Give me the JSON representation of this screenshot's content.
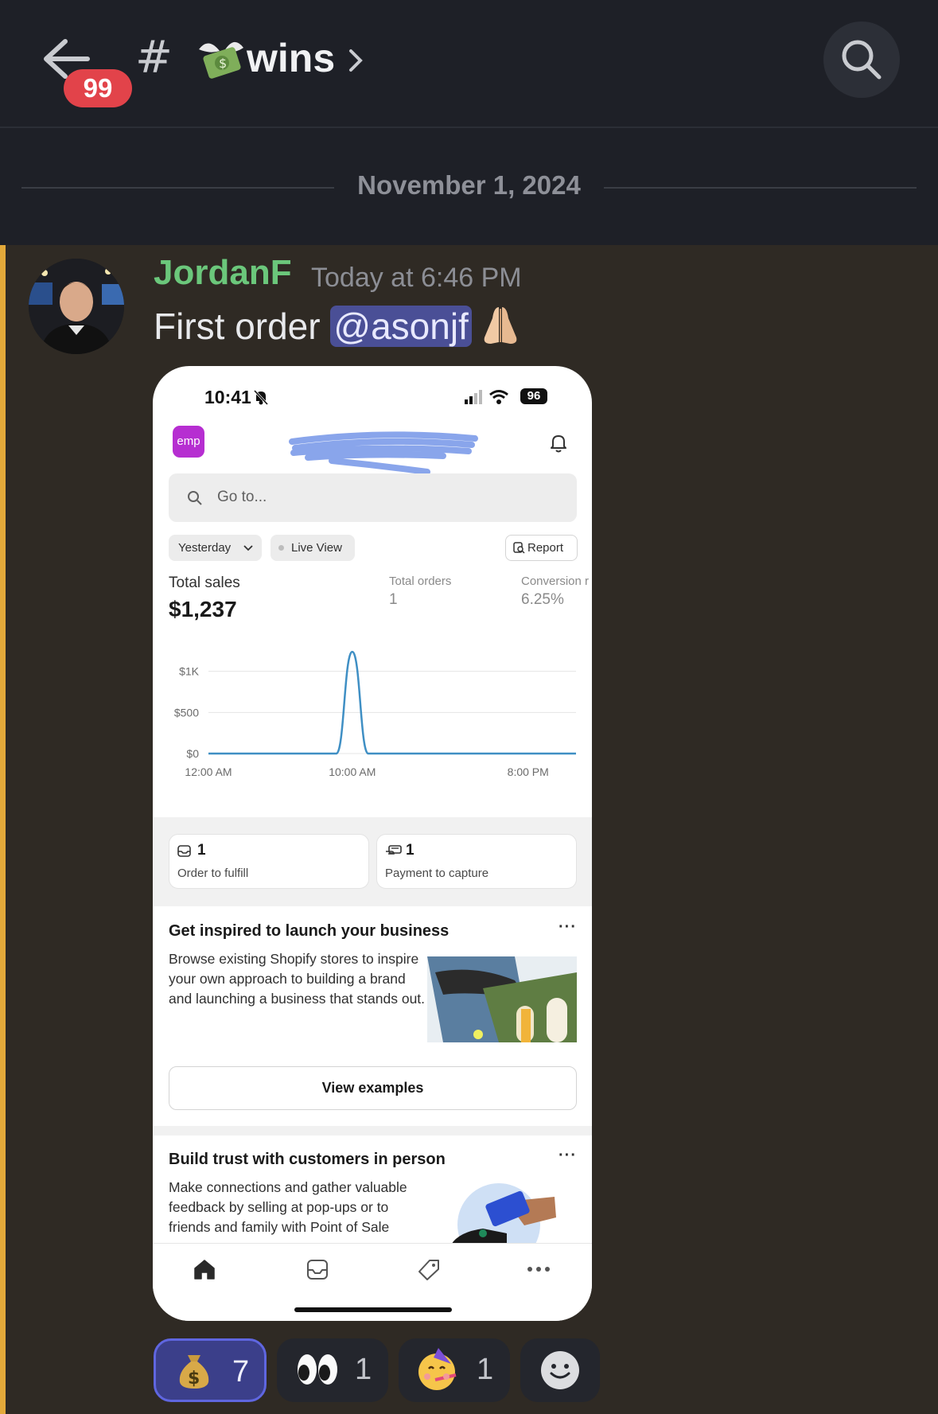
{
  "header": {
    "unread_badge": "99",
    "channel_prefix": "#",
    "channel_name": "wins",
    "channel_emoji": "money-with-wings-icon"
  },
  "date_divider": "November 1, 2024",
  "message": {
    "author": "JordanF",
    "timestamp": "Today at 6:46 PM",
    "text_before": "First order",
    "mention": "@asonjf",
    "emoji": "folded-hands-icon",
    "colors": {
      "author": "#6bc77b",
      "accent_bar": "#e3a93a",
      "mention_bg": "#4a4f96"
    }
  },
  "screenshot": {
    "status_time": "10:41",
    "battery": "96",
    "logo_text": "emp",
    "search_placeholder": "Go to...",
    "filter_period": "Yesterday",
    "live_view": "Live View",
    "report": "Report",
    "total_sales_label": "Total sales",
    "total_sales_value": "$1,237",
    "total_orders_label": "Total orders",
    "total_orders_value": "1",
    "conversion_label": "Conversion r",
    "conversion_value": "6.25%",
    "chart_data": {
      "type": "line",
      "y_ticks": [
        "$1K",
        "$500",
        "$0"
      ],
      "x_ticks": [
        "12:00 AM",
        "10:00 AM",
        "8:00 PM"
      ],
      "ylim": [
        0,
        1200
      ],
      "series": [
        {
          "values": [
            0,
            0,
            0,
            0,
            0,
            0,
            0,
            0,
            0,
            1237,
            0,
            0,
            0,
            0,
            0,
            0,
            0,
            0,
            0,
            0,
            0,
            0,
            0,
            0
          ]
        }
      ]
    },
    "cards": [
      {
        "value": "1",
        "label": "Order to fulfill",
        "icon": "inbox-icon"
      },
      {
        "value": "1",
        "label": "Payment to capture",
        "icon": "cash-icon"
      }
    ],
    "inspire": {
      "title": "Get inspired to launch your business",
      "body": "Browse existing Shopify stores to inspire your own approach to building a brand and launching a business that stands out.",
      "button": "View examples",
      "more": "···"
    },
    "trust": {
      "title": "Build trust with customers in person",
      "body": "Make connections and gather valuable feedback by selling at pop-ups or to friends and family with Point of Sale",
      "more": "···"
    },
    "tabs": [
      "home-icon",
      "orders-icon",
      "products-icon",
      "more-icon"
    ]
  },
  "reactions": [
    {
      "emoji": "money-bag-icon",
      "count": "7",
      "active": true
    },
    {
      "emoji": "eyes-icon",
      "count": "1",
      "active": false
    },
    {
      "emoji": "partying-face-icon",
      "count": "1",
      "active": false
    }
  ]
}
